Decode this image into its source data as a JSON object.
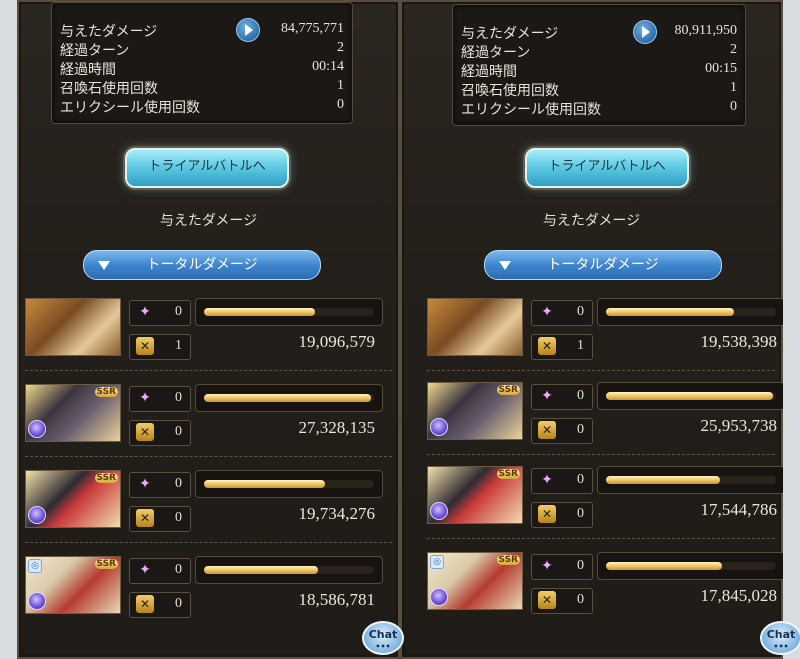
{
  "panels": [
    {
      "stats": {
        "damage_label": "与えたダメージ",
        "damage_value": "84,775,771",
        "turns_label": "経過ターン",
        "turns_value": "2",
        "time_label": "経過時間",
        "time_value": "00:14",
        "summon_label": "召喚石使用回数",
        "summon_value": "1",
        "elixir_label": "エリクシール使用回数",
        "elixir_value": "0"
      },
      "trial_button": "トライアルバトルへ",
      "section_title": "与えたダメージ",
      "total_button": "トータルダメージ",
      "characters": [
        {
          "skill": "0",
          "ca": "1",
          "damage": "19,096,579",
          "bar_fraction": 0.65,
          "ssr": ""
        },
        {
          "skill": "0",
          "ca": "0",
          "damage": "27,328,135",
          "bar_fraction": 0.98,
          "ssr": "SSR"
        },
        {
          "skill": "0",
          "ca": "0",
          "damage": "19,734,276",
          "bar_fraction": 0.71,
          "ssr": "SSR"
        },
        {
          "skill": "0",
          "ca": "0",
          "damage": "18,586,781",
          "bar_fraction": 0.67,
          "ssr": "SSR"
        }
      ]
    },
    {
      "stats": {
        "damage_label": "与えたダメージ",
        "damage_value": "80,911,950",
        "turns_label": "経過ターン",
        "turns_value": "2",
        "time_label": "経過時間",
        "time_value": "00:15",
        "summon_label": "召喚石使用回数",
        "summon_value": "1",
        "elixir_label": "エリクシール使用回数",
        "elixir_value": "0"
      },
      "trial_button": "トライアルバトルへ",
      "section_title": "与えたダメージ",
      "total_button": "トータルダメージ",
      "characters": [
        {
          "skill": "0",
          "ca": "1",
          "damage": "19,538,398",
          "bar_fraction": 0.75,
          "ssr": ""
        },
        {
          "skill": "0",
          "ca": "0",
          "damage": "25,953,738",
          "bar_fraction": 0.98,
          "ssr": "SSR"
        },
        {
          "skill": "0",
          "ca": "0",
          "damage": "17,544,786",
          "bar_fraction": 0.67,
          "ssr": "SSR"
        },
        {
          "skill": "0",
          "ca": "0",
          "damage": "17,845,028",
          "bar_fraction": 0.68,
          "ssr": "SSR"
        }
      ]
    }
  ],
  "chat_label": "Chat",
  "colors": {
    "accent_bar": "#f0c768",
    "trial_button": "#5fcbe4",
    "total_button": "#3f86cf"
  }
}
